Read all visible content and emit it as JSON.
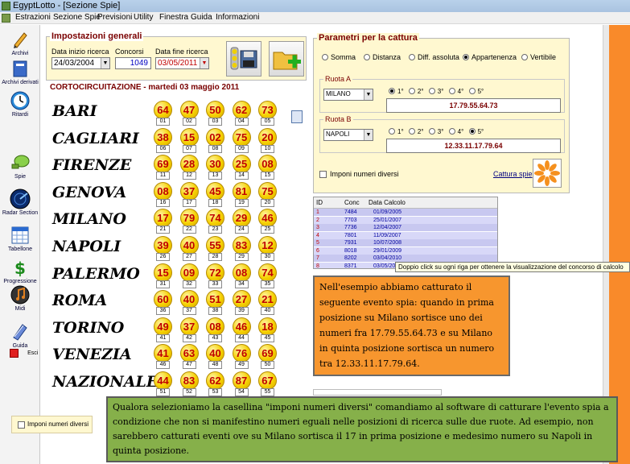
{
  "window": {
    "title": "EgyptLotto - [Sezione Spie]"
  },
  "menu": [
    "Estrazioni",
    "Sezione Spie",
    "Previsioni",
    "Utility",
    "Finestra",
    "Guida",
    "Informazioni"
  ],
  "sidebar": [
    {
      "label": "Archivi",
      "icon": "pencil-icon"
    },
    {
      "label": "Archivi derivati",
      "icon": "book-icon"
    },
    {
      "label": "Ritardi",
      "icon": "clock-icon"
    },
    {
      "label": "Spie",
      "icon": "spyglass-icon"
    },
    {
      "label": "Radar Section",
      "icon": "radar-icon"
    },
    {
      "label": "Tabellone",
      "icon": "calendar-icon"
    },
    {
      "label": "Progressione",
      "icon": "dollar-icon"
    },
    {
      "label": "Midi",
      "icon": "music-icon"
    },
    {
      "label": "Guida",
      "icon": "help-book-icon"
    },
    {
      "label": "Esci",
      "icon": "exit-icon"
    }
  ],
  "settings": {
    "title": "Impostazioni generali",
    "start_label": "Data inizio ricerca",
    "start_value": "24/03/2004",
    "contests_label": "Concorsi",
    "contests_value": "1049",
    "end_label": "Data fine ricerca",
    "end_value": "03/05/2011"
  },
  "lotto": {
    "header": "CORTOCIRCUITAZIONE - martedi 03 maggio 2011",
    "wheels": [
      {
        "name": "BARI",
        "numbers": [
          "64",
          "47",
          "50",
          "62",
          "73"
        ],
        "positions": [
          "01",
          "02",
          "03",
          "04",
          "05"
        ]
      },
      {
        "name": "CAGLIARI",
        "numbers": [
          "38",
          "15",
          "02",
          "75",
          "20"
        ],
        "positions": [
          "06",
          "07",
          "08",
          "09",
          "10"
        ]
      },
      {
        "name": "FIRENZE",
        "numbers": [
          "69",
          "28",
          "30",
          "25",
          "08"
        ],
        "positions": [
          "11",
          "12",
          "13",
          "14",
          "15"
        ]
      },
      {
        "name": "GENOVA",
        "numbers": [
          "08",
          "37",
          "45",
          "81",
          "75"
        ],
        "positions": [
          "16",
          "17",
          "18",
          "19",
          "20"
        ]
      },
      {
        "name": "MILANO",
        "numbers": [
          "17",
          "79",
          "74",
          "29",
          "46"
        ],
        "positions": [
          "21",
          "22",
          "23",
          "24",
          "25"
        ]
      },
      {
        "name": "NAPOLI",
        "numbers": [
          "39",
          "40",
          "55",
          "83",
          "12"
        ],
        "positions": [
          "26",
          "27",
          "28",
          "29",
          "30"
        ]
      },
      {
        "name": "PALERMO",
        "numbers": [
          "15",
          "09",
          "72",
          "08",
          "74"
        ],
        "positions": [
          "31",
          "32",
          "33",
          "34",
          "35"
        ]
      },
      {
        "name": "ROMA",
        "numbers": [
          "60",
          "40",
          "51",
          "27",
          "21"
        ],
        "positions": [
          "36",
          "37",
          "38",
          "39",
          "40"
        ]
      },
      {
        "name": "TORINO",
        "numbers": [
          "49",
          "37",
          "08",
          "46",
          "18"
        ],
        "positions": [
          "41",
          "42",
          "43",
          "44",
          "45"
        ]
      },
      {
        "name": "VENEZIA",
        "numbers": [
          "41",
          "63",
          "40",
          "76",
          "69"
        ],
        "positions": [
          "46",
          "47",
          "48",
          "49",
          "50"
        ]
      },
      {
        "name": "NAZIONALE",
        "numbers": [
          "44",
          "83",
          "62",
          "87",
          "67"
        ],
        "positions": [
          "51",
          "52",
          "53",
          "54",
          "55"
        ]
      }
    ]
  },
  "params": {
    "title": "Parametri per la cattura",
    "modes": [
      "Somma",
      "Distanza",
      "Diff. assoluta",
      "Appartenenza",
      "Vertibile"
    ],
    "mode_selected": 3,
    "ruota_a": {
      "title": "Ruota A",
      "wheel": "MILANO",
      "positions": [
        "1°",
        "2°",
        "3°",
        "4°",
        "5°"
      ],
      "selected": 0,
      "numbers": "17.79.55.64.73"
    },
    "ruota_b": {
      "title": "Ruota B",
      "wheel": "NAPOLI",
      "positions": [
        "1°",
        "2°",
        "3°",
        "4°",
        "5°"
      ],
      "selected": 4,
      "numbers": "12.33.11.17.79.64"
    },
    "distinct_label": "Imponi numeri diversi",
    "capture_link": "Cattura spie"
  },
  "results": {
    "headers": [
      "ID",
      "Conc",
      "Data Calcolo"
    ],
    "rows": [
      {
        "id": "1",
        "conc": "7484",
        "date": "01/09/2005"
      },
      {
        "id": "2",
        "conc": "7703",
        "date": "25/01/2007"
      },
      {
        "id": "3",
        "conc": "7736",
        "date": "12/04/2007"
      },
      {
        "id": "4",
        "conc": "7801",
        "date": "11/09/2007"
      },
      {
        "id": "5",
        "conc": "7931",
        "date": "10/07/2008"
      },
      {
        "id": "6",
        "conc": "8018",
        "date": "29/01/2009"
      },
      {
        "id": "7",
        "conc": "8202",
        "date": "03/04/2010"
      },
      {
        "id": "8",
        "conc": "8371",
        "date": "03/05/2011"
      }
    ],
    "tooltip": "Doppio click su ogni riga per ottenere la visualizzazione del concorso di calcolo"
  },
  "notes": {
    "orange": "Nell'esempio abbiamo catturato il seguente evento spia: quando in prima posizione su Milano sortisce uno dei numeri fra 17.79.55.64.73 e su Milano in quinta posizione sortisca un numero tra 12.33.11.17.79.64.",
    "green": "Qualora selezioniamo la casellina \"imponi numeri diversi\" comandiamo al software di catturare l'evento spia a condizione che non si manifestino numeri eguali nelle posizioni di ricerca sulle due ruote. Ad esempio, non sarebbero catturati eventi ove su Milano sortisca il 17 in prima posizione e medesimo numero su Napoli in quinta posizione."
  },
  "bottom_checkbox_label": "Imponi numeri diversi"
}
